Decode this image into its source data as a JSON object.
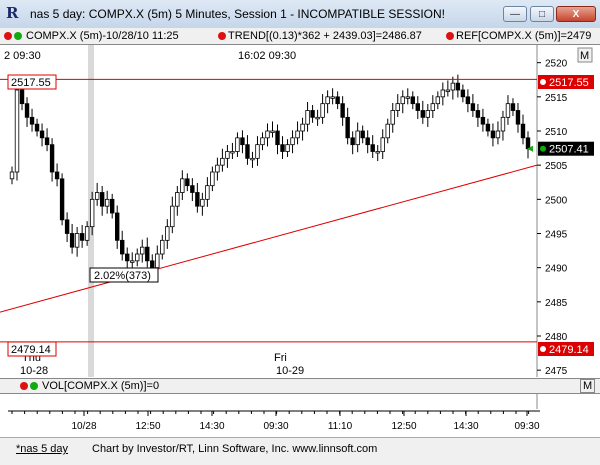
{
  "window": {
    "title": "nas 5 day: COMPX.X (5m) 5 Minutes, Session 1 - INCOMPATIBLE SESSION!",
    "min_glyph": "—",
    "max_glyph": "□",
    "close_glyph": "X",
    "app_glyph": "R"
  },
  "legend": {
    "series1": "COMPX.X (5m)-10/28/10 11:25",
    "series2": "TREND[(0.13)*362 + 2439.03]=2486.87",
    "series3": "REF[COMPX.X (5m)]=2479",
    "menu_label": "M"
  },
  "chart_data": {
    "type": "candlestick",
    "y_ticks": [
      "2520",
      "2515",
      "2510",
      "2505",
      "2500",
      "2495",
      "2490",
      "2485",
      "2480",
      "2475"
    ],
    "ylim": [
      2474,
      2522
    ],
    "top_left_label": "2  09:30",
    "session_label": "16:02  09:30",
    "day_labels": [
      {
        "day": "Thu",
        "date": "10-28"
      },
      {
        "day": "Fri",
        "date": "10-29"
      }
    ],
    "reference_lines": [
      {
        "label": "2517.55",
        "value": 2517.55,
        "color": "#dd0000"
      },
      {
        "label": "2479.14",
        "value": 2479.14,
        "color": "#dd0000"
      }
    ],
    "last_price": {
      "label": "2507.41",
      "value": 2507.41
    },
    "trend_line": {
      "start": 2483.5,
      "end": 2505.0,
      "color": "#dd0000"
    },
    "annotation": "2.02%(373)",
    "closes": [
      2504,
      2516,
      2514,
      2512,
      2511,
      2510,
      2509,
      2508,
      2504,
      2503,
      2497,
      2495,
      2493,
      2495,
      2494,
      2496,
      2500,
      2501,
      2499,
      2500,
      2498,
      2494,
      2492,
      2491,
      2491,
      2492,
      2493,
      2491,
      2490,
      2492,
      2494,
      2496,
      2499,
      2501,
      2503,
      2502,
      2501,
      2499,
      2500,
      2502,
      2504,
      2505,
      2506,
      2507,
      2507,
      2509,
      2508,
      2506,
      2506,
      2508,
      2509,
      2510,
      2510,
      2508,
      2507,
      2508,
      2509,
      2510,
      2511,
      2513,
      2512,
      2512,
      2514,
      2515,
      2515,
      2514,
      2512,
      2509,
      2508,
      2510,
      2509,
      2508,
      2507,
      2507,
      2509,
      2511,
      2513,
      2514,
      2515,
      2515,
      2514,
      2513,
      2512,
      2513,
      2514,
      2515,
      2516,
      2516,
      2517,
      2516,
      2515,
      2514,
      2513,
      2512,
      2511,
      2510,
      2509,
      2510,
      2512,
      2514,
      2513,
      2511,
      2509,
      2507.4
    ],
    "volume_label": "VOL[COMPX.X (5m)]=0",
    "x_tick_labels": [
      "10/28",
      "12:50",
      "14:30",
      "09:30",
      "11:10",
      "12:50",
      "14:30",
      "09:30"
    ]
  },
  "footer": {
    "tab_label": "*nas 5 day",
    "credits": "Chart by Investor/RT, Linn Software, Inc. www.linnsoft.com"
  }
}
